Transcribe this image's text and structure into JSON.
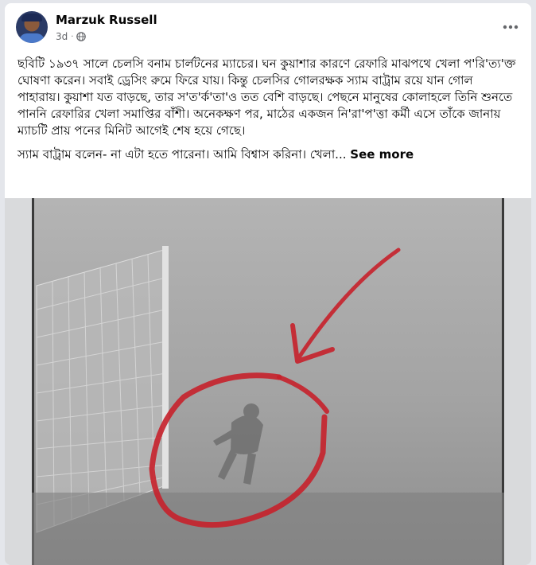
{
  "post": {
    "author": "Marzuk Russell",
    "time": "3d",
    "separator": "·",
    "more_icon": "ellipsis-icon",
    "privacy_icon": "globe-icon",
    "paragraph1": "ছবিটি ১৯৩৭ সালে চেলসি বনাম চার্লটনের ম্যাচের। ঘন কুয়াশার কারণে রেফারি মাঝপথে খেলা প'রি'ত্য'ক্ত ঘোষণা করেন। সবাই ড্রেসিং রুমে ফিরে যায়। কিন্তু চেলসির গোলরক্ষক স্যাম বাট্রাম রয়ে যান গোল পাহারায়। কুয়াশা যত বাড়ছে, তার স'ত'র্ক'তা'ও তত বেশি বাড়ছে। পেছনে মানুষের কোলাহলে তিনি শুনতে পাননি রেফারির খেলা সমাপ্তির বাঁশী। অনেকক্ষণ পর, মাঠের একজন নি'রা'প'ত্তা কর্মী এসে তাঁকে জানায় ম্যাচটি প্রায় পনের মিনিট আগেই শেষ হয়ে গেছে।",
    "paragraph2": "স্যাম বাট্রাম বলেন- না এটা হতে পারেনা। আমি বিশ্বাস করিনা। খেলা...",
    "see_more": "See more"
  },
  "photo": {
    "annotation_color": "#c7212b",
    "background_color": "#9c9c9c"
  }
}
